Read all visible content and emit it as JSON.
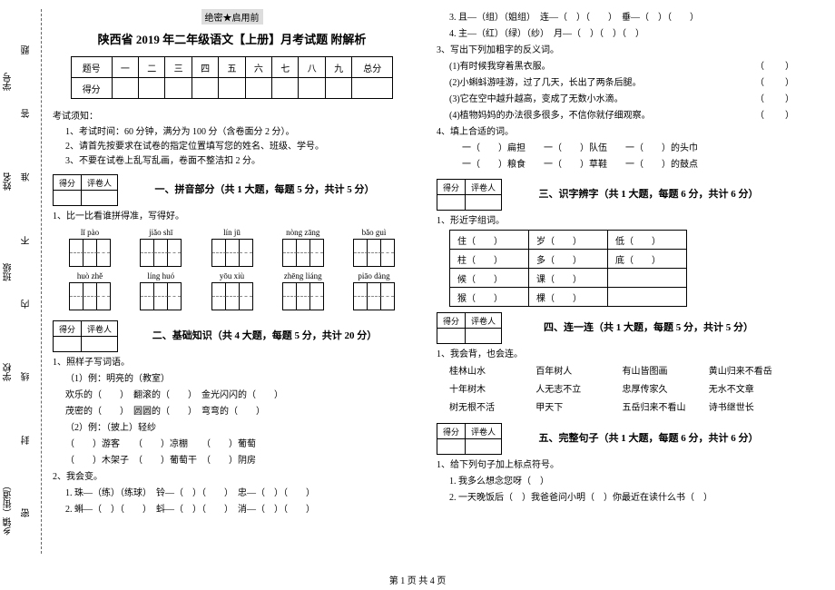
{
  "side": {
    "l1": "乡镇（街道）",
    "l2": "学校",
    "l3": "班级",
    "l4": "姓名",
    "l5": "学号",
    "c1": "密",
    "c2": "封",
    "c3": "线",
    "c4": "内",
    "c5": "不",
    "c6": "准",
    "c7": "答",
    "c8": "题"
  },
  "banner": "绝密★启用前",
  "title": "陕西省 2019 年二年级语文【上册】月考试题 附解析",
  "score_head": [
    "题号",
    "一",
    "二",
    "三",
    "四",
    "五",
    "六",
    "七",
    "八",
    "九",
    "总分"
  ],
  "score_row_label": "得分",
  "notice_title": "考试须知：",
  "notice1": "1、考试时间：60 分钟，满分为 100 分（含卷面分 2 分）。",
  "notice2": "2、请首先按要求在试卷的指定位置填写您的姓名、班级、学号。",
  "notice3": "3、不要在试卷上乱写乱画，卷面不整洁扣 2 分。",
  "scorebox": {
    "a": "得分",
    "b": "评卷人"
  },
  "part1_title": "一、拼音部分（共 1 大题，每题 5 分，共计 5 分）",
  "q1_1": "1、比一比看谁拼得准，写得好。",
  "py": {
    "r1": [
      "lǐ  pào",
      "jiǎo  shī",
      "lín  jū",
      "nòng  zāng",
      "bǎo  guì"
    ],
    "r2": [
      "huò  zhě",
      "líng  huó",
      "yōu  xiù",
      "zhēng liáng",
      "piāo dàng"
    ]
  },
  "part2_title": "二、基础知识（共 4 大题，每题 5 分，共计 20 分）",
  "q2_1": "1、照样子写词语。",
  "q2_1a": "（1）例：明亮的（教室）",
  "q2_1a1": "欢乐的（　　）　翻滚的（　　）　金光闪闪的（　　）",
  "q2_1a2": "茂密的（　　）　圆圆的（　　）　弯弯的（　　）",
  "q2_1b": "（2）例：（披上）轻纱",
  "q2_1b1": "（　　）游客　　（　　）凉棚　　（　　）葡萄",
  "q2_1b2": "（　　）木架子　（　　）葡萄干　（　　）阴房",
  "q2_2": "2、我会变。",
  "q2_2a": "1. 珠—（练）（练球）　铃—（　）（　　）　忠—（　）（　　）",
  "q2_2b": "2. 蝌—（　）（　　）　蚪—（　）（　　）　消—（　）（　　）",
  "rcol": {
    "l1": "3. 且—（组）（姐组）　连—（　）（　　）　垂—（　）（　　）",
    "l2": "4. 主—（红）（绿）（纱）　月—（　）（　）（　）",
    "q3": "3、写出下列加粗字的反义词。",
    "q3a": "(1)有时候我穿着黑衣服。",
    "q3b": "(2)小蝌蚪游哇游，过了几天，长出了两条后腿。",
    "q3c": "(3)它在空中越升越高，变成了无数小水滴。",
    "q3d": "(4)植物妈妈的办法很多很多，不信你就仔细观察。",
    "q4": "4、填上合适的词。",
    "q4a": "一（　　）扁担　　一（　　）队伍　　一（　　）的头巾",
    "q4b": "一（　　）粮食　　一（　　）草鞋　　一（　　）的鼓点",
    "part3_title": "三、识字辨字（共 1 大题，每题 6 分，共计 6 分）",
    "q3_1": "1、形近字组词。",
    "zi": [
      [
        "住（　　）",
        "岁（　　）",
        "低（　　）"
      ],
      [
        "柱（　　）",
        "多（　　）",
        "底（　　）"
      ],
      [
        "候（　　）",
        "课（　　）",
        "",
        ""
      ],
      [
        "猴（　　）",
        "棵（　　）",
        "",
        ""
      ]
    ],
    "part4_title": "四、连一连（共 1 大题，每题 5 分，共计 5 分）",
    "q4_1": "1、我会背，也会连。",
    "lian": {
      "c1": [
        "桂林山水",
        "十年树木",
        "树无根不活"
      ],
      "c2": [
        "百年树人",
        "人无志不立",
        "甲天下"
      ],
      "c3": [
        "有山皆图画",
        "忠厚传家久",
        "五岳归来不看山"
      ],
      "c4": [
        "黄山归来不看岳",
        "无水不文章",
        "诗书继世长"
      ]
    },
    "part5_title": "五、完整句子（共 1 大题，每题 6 分，共计 6 分）",
    "q5_1": "1、给下列句子加上标点符号。",
    "q5_1a": "1. 我多么想念您呀（　）",
    "q5_1b": "2. 一天晚饭后（　）我爸爸问小明（　）你最近在读什么书（　）"
  },
  "footer": "第 1 页 共 4 页"
}
